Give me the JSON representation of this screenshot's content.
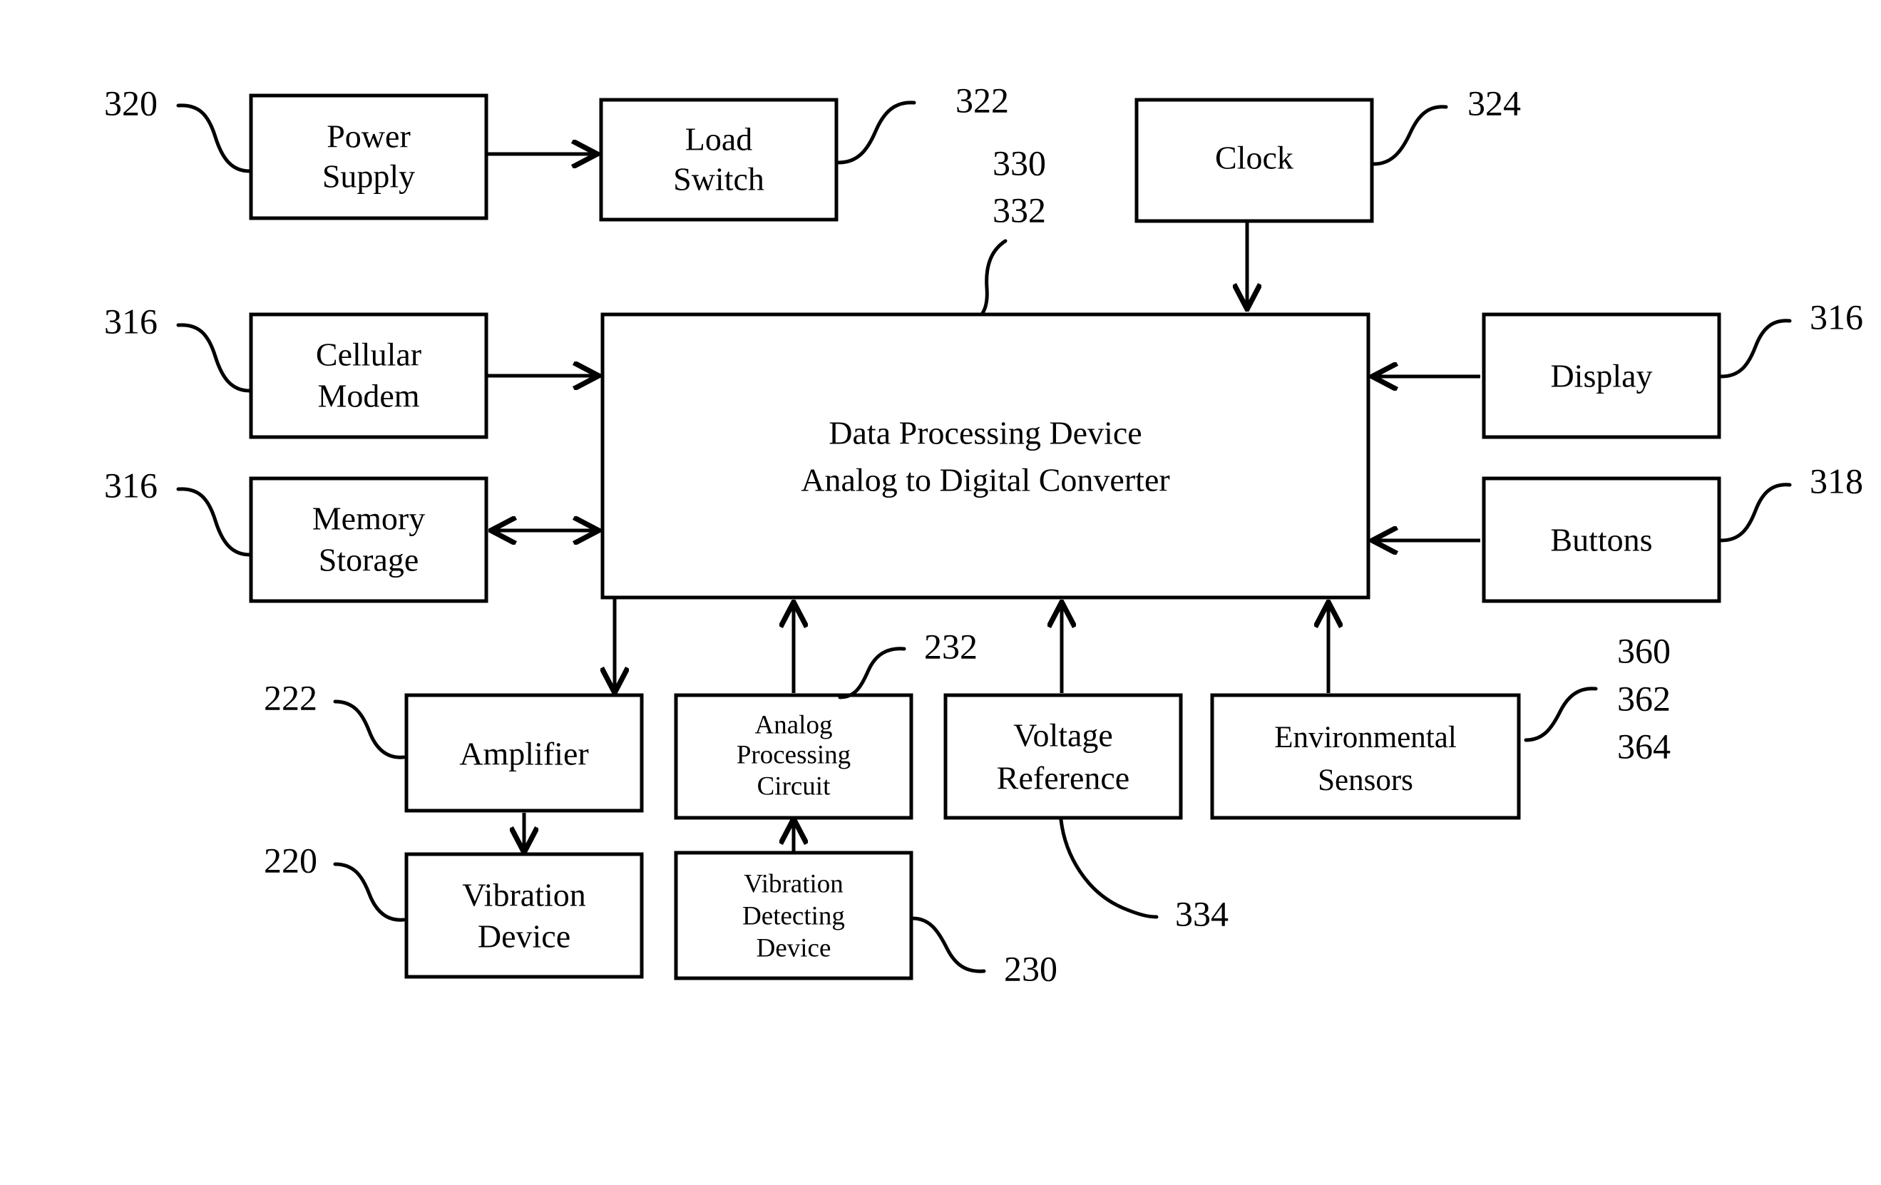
{
  "diagram": {
    "type": "patent-block-diagram",
    "background_color": "#ffffff",
    "line_color": "#000000",
    "boxes": [
      {
        "id": "power_supply",
        "lines": [
          "Power",
          "Supply"
        ],
        "ref": "320"
      },
      {
        "id": "load_switch",
        "lines": [
          "Load",
          "Switch"
        ],
        "ref": "322"
      },
      {
        "id": "clock",
        "lines": [
          "Clock"
        ],
        "ref": "324"
      },
      {
        "id": "cellular_modem",
        "lines": [
          "Cellular",
          "Modem"
        ],
        "ref": "316"
      },
      {
        "id": "memory_storage",
        "lines": [
          "Memory",
          "Storage"
        ],
        "ref": "316"
      },
      {
        "id": "data_processing",
        "lines": [
          "Data Processing Device",
          "Analog to Digital Converter"
        ],
        "ref": "330 332"
      },
      {
        "id": "display",
        "lines": [
          "Display"
        ],
        "ref": "316"
      },
      {
        "id": "buttons",
        "lines": [
          "Buttons"
        ],
        "ref": "318"
      },
      {
        "id": "amplifier",
        "lines": [
          "Amplifier"
        ],
        "ref": "222"
      },
      {
        "id": "vibration_device",
        "lines": [
          "Vibration",
          "Device"
        ],
        "ref": "220"
      },
      {
        "id": "analog_processing",
        "lines": [
          "Analog",
          "Processing",
          "Circuit"
        ],
        "ref": "232"
      },
      {
        "id": "vibration_detecting",
        "lines": [
          "Vibration",
          "Detecting",
          "Device"
        ],
        "ref": "230"
      },
      {
        "id": "voltage_reference",
        "lines": [
          "Voltage",
          "Reference"
        ],
        "ref": "334"
      },
      {
        "id": "environmental_sensors",
        "lines": [
          "Environmental",
          "Sensors"
        ],
        "ref": "360 362 364"
      }
    ],
    "labels": {
      "power_supply_l1": "Power",
      "power_supply_l2": "Supply",
      "load_switch_l1": "Load",
      "load_switch_l2": "Switch",
      "clock_l1": "Clock",
      "cellular_modem_l1": "Cellular",
      "cellular_modem_l2": "Modem",
      "memory_storage_l1": "Memory",
      "memory_storage_l2": "Storage",
      "data_processing_l1": "Data Processing Device",
      "data_processing_l2": "Analog to Digital Converter",
      "display_l1": "Display",
      "buttons_l1": "Buttons",
      "amplifier_l1": "Amplifier",
      "vibration_device_l1": "Vibration",
      "vibration_device_l2": "Device",
      "analog_processing_l1": "Analog",
      "analog_processing_l2": "Processing",
      "analog_processing_l3": "Circuit",
      "vibration_detecting_l1": "Vibration",
      "vibration_detecting_l2": "Detecting",
      "vibration_detecting_l3": "Device",
      "voltage_reference_l1": "Voltage",
      "voltage_reference_l2": "Reference",
      "environmental_sensors_l1": "Environmental",
      "environmental_sensors_l2": "Sensors"
    },
    "reference_numerals": {
      "n320": "320",
      "n322": "322",
      "n324": "324",
      "n330": "330",
      "n332": "332",
      "n316_modem": "316",
      "n316_memory": "316",
      "n316_display": "316",
      "n318": "318",
      "n222": "222",
      "n220": "220",
      "n232": "232",
      "n230": "230",
      "n334": "334",
      "n360": "360",
      "n362": "362",
      "n364": "364"
    },
    "connections": [
      {
        "from": "power_supply",
        "to": "load_switch",
        "direction": "right"
      },
      {
        "from": "clock",
        "to": "data_processing",
        "direction": "down"
      },
      {
        "from": "cellular_modem",
        "to": "data_processing",
        "direction": "right"
      },
      {
        "from": "memory_storage",
        "to": "data_processing",
        "direction": "bidirectional"
      },
      {
        "from": "display",
        "to": "data_processing",
        "direction": "left"
      },
      {
        "from": "buttons",
        "to": "data_processing",
        "direction": "left"
      },
      {
        "from": "data_processing",
        "to": "amplifier",
        "direction": "down"
      },
      {
        "from": "amplifier",
        "to": "vibration_device",
        "direction": "down"
      },
      {
        "from": "analog_processing",
        "to": "data_processing",
        "direction": "up"
      },
      {
        "from": "vibration_detecting",
        "to": "analog_processing",
        "direction": "up"
      },
      {
        "from": "voltage_reference",
        "to": "data_processing",
        "direction": "up"
      },
      {
        "from": "environmental_sensors",
        "to": "data_processing",
        "direction": "up"
      }
    ]
  }
}
